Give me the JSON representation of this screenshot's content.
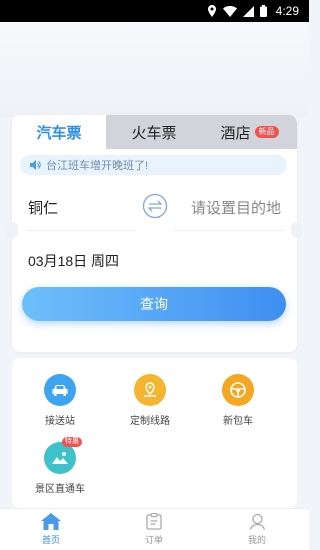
{
  "status_bar": {
    "time": "4:29"
  },
  "booking": {
    "tabs": [
      {
        "label": "汽车票",
        "active": true
      },
      {
        "label": "火车票",
        "active": false
      },
      {
        "label": "酒店",
        "active": false,
        "badge": "新品"
      }
    ],
    "notice": "台江班车增开晚班了!",
    "from_city": "铜仁",
    "to_placeholder": "请设置目的地",
    "date": "03月18日 周四",
    "search_label": "查询"
  },
  "services": [
    {
      "label": "接送站",
      "icon": "car-icon",
      "color": "#3da5f0"
    },
    {
      "label": "定制线路",
      "icon": "route-icon",
      "color": "#f5b531"
    },
    {
      "label": "新包车",
      "icon": "steering-wheel-icon",
      "color": "#f5a623"
    },
    {
      "label": "景区直通车",
      "icon": "scenic-icon",
      "color": "#3fc1c9",
      "badge": "特惠"
    }
  ],
  "tabbar": [
    {
      "label": "首页",
      "active": true
    },
    {
      "label": "订单",
      "active": false
    },
    {
      "label": "我的",
      "active": false
    }
  ],
  "colors": {
    "accent": "#2e8ff0",
    "badge": "#f0524f"
  }
}
